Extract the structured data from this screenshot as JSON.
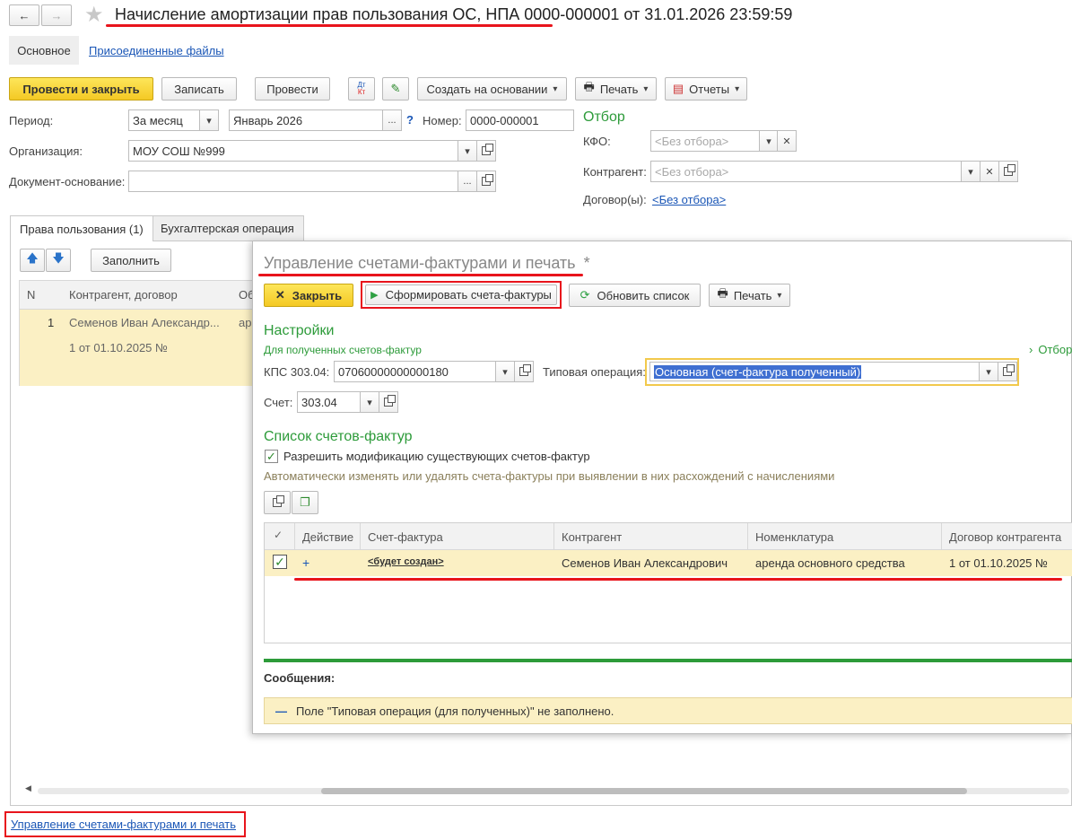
{
  "header": {
    "title": "Начисление амортизации прав пользования ОС, НПА 0000-000001 от 31.01.2026 23:59:59",
    "tabs": [
      "Основное",
      "Присоединенные файлы"
    ]
  },
  "toolbar": {
    "post_close": "Провести и закрыть",
    "save": "Записать",
    "post": "Провести",
    "dtkt_top": "Дт",
    "dtkt_bottom": "Кт",
    "create_based": "Создать на основании",
    "print": "Печать",
    "reports": "Отчеты"
  },
  "form": {
    "period_label": "Период:",
    "period_type": "За месяц",
    "period_value": "Январь 2026",
    "help": "?",
    "number_label": "Номер:",
    "number_value": "0000-000001",
    "org_label": "Организация:",
    "org_value": "МОУ СОШ №999",
    "basis_label": "Документ-основание:",
    "basis_value": ""
  },
  "filter": {
    "title": "Отбор",
    "kfo_label": "КФО:",
    "kfo_placeholder": "<Без отбора>",
    "contractor_label": "Контрагент:",
    "contractor_placeholder": "<Без отбора>",
    "contracts_label": "Договор(ы):",
    "contracts_value": "<Без отбора>"
  },
  "lower_tabs": [
    "Права пользования (1)",
    "Бухгалтерская операция"
  ],
  "rights_table": {
    "fill_button": "Заполнить",
    "columns": [
      "N",
      "Контрагент, договор",
      "Об"
    ],
    "row": {
      "n": "1",
      "contractor": "Семенов Иван Александр...",
      "contract": "1 от 01.10.2025 №",
      "obj": "ар"
    }
  },
  "footer_link": "Управление счетами-фактурами и печать",
  "dialog": {
    "title": "Управление счетами-фактурами и печать",
    "modified_mark": "*",
    "close_button": "Закрыть",
    "generate_button": "Сформировать счета-фактуры",
    "refresh_button": "Обновить список",
    "print_button": "Печать",
    "settings_title": "Настройки",
    "received_subtitle": "Для полученных счетов-фактур",
    "filter_link": "Отбор",
    "kps_label": "КПС 303.04:",
    "kps_value": "07060000000000180",
    "op_label": "Типовая операция:",
    "op_value": "Основная (счет-фактура полученный)",
    "account_label": "Счет:",
    "account_value": "303.04",
    "invoices_title": "Список счетов-фактур",
    "allow_modify_label": "Разрешить модификацию существующих счетов-фактур",
    "auto_hint": "Автоматически изменять или удалять счета-фактуры при выявлении в них расхождений с начислениями",
    "columns": [
      "Действие",
      "Счет-фактура",
      "Контрагент",
      "Номенклатура",
      "Договор контрагента"
    ],
    "row": {
      "action": "+",
      "invoice": "<будет создан>",
      "contractor": "Семенов Иван Александрович",
      "nomenclature": "аренда основного средства",
      "contract": "1 от 01.10.2025 №"
    },
    "messages_title": "Сообщения:",
    "message": "Поле \"Типовая операция (для полученных)\" не заполнено."
  }
}
